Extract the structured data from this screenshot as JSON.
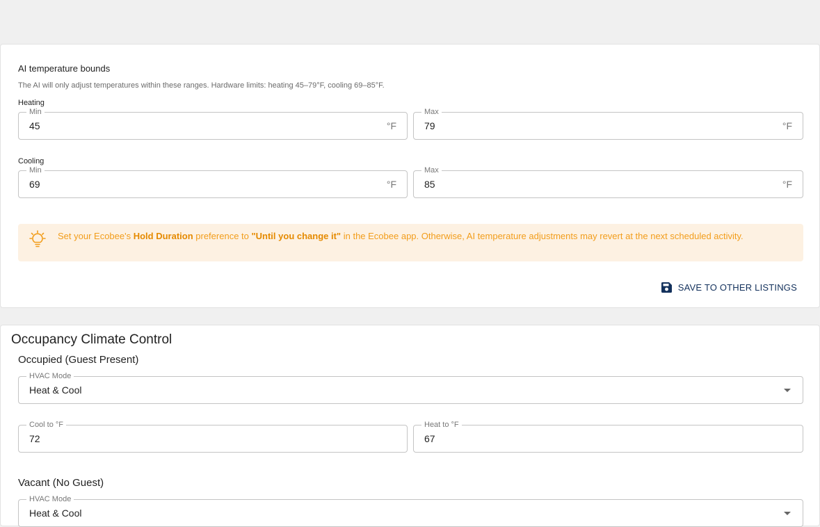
{
  "bounds": {
    "title": "AI temperature bounds",
    "description": "The AI will only adjust temperatures within these ranges. Hardware limits: heating 45–79°F, cooling 69–85°F.",
    "heating": {
      "label": "Heating",
      "min_label": "Min",
      "min_value": "45",
      "max_label": "Max",
      "max_value": "79",
      "unit": "°F"
    },
    "cooling": {
      "label": "Cooling",
      "min_label": "Min",
      "min_value": "69",
      "max_label": "Max",
      "max_value": "85",
      "unit": "°F"
    },
    "alert": {
      "part1": "Set your Ecobee's ",
      "bold1": "Hold Duration",
      "part2": " preference to ",
      "bold2": "\"Until you change it\"",
      "part3": " in the Ecobee app. Otherwise, AI temperature adjustments may revert at the next scheduled activity.",
      "icon": "lightbulb-icon"
    },
    "save_label": "SAVE TO OTHER LISTINGS"
  },
  "occupancy": {
    "title": "Occupancy Climate Control",
    "occupied": {
      "heading": "Occupied (Guest Present)",
      "hvac_label": "HVAC Mode",
      "hvac_value": "Heat & Cool",
      "cool_label": "Cool to °F",
      "cool_value": "72",
      "heat_label": "Heat to °F",
      "heat_value": "67"
    },
    "vacant": {
      "heading": "Vacant (No Guest)",
      "hvac_label": "HVAC Mode",
      "hvac_value": "Heat & Cool"
    }
  },
  "colors": {
    "background": "#f0f0f0",
    "alert_bg": "#fdf1e2",
    "alert_text": "#f29d1b",
    "button_text": "#13315c"
  }
}
